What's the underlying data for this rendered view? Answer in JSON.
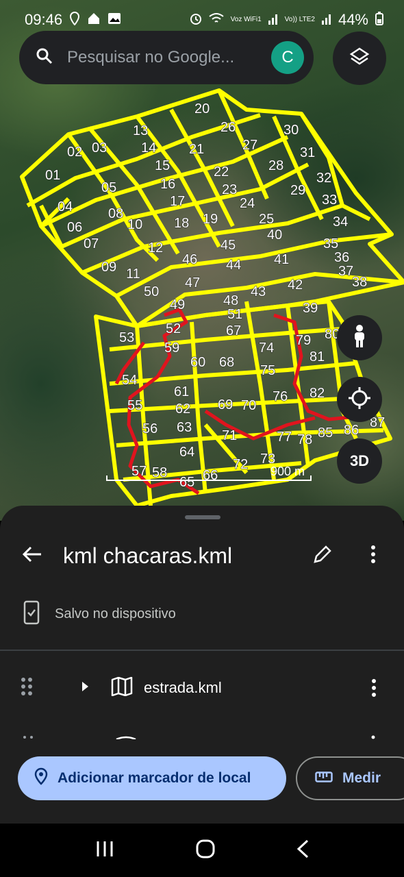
{
  "status_bar": {
    "time": "09:46",
    "battery": "44%",
    "network_label_1": "Voz WiFi1",
    "network_label_2": "Vo)) LTE2"
  },
  "search": {
    "placeholder": "Pesquisar no Google...",
    "avatar_letter": "C"
  },
  "map": {
    "plot_labels": [
      "01",
      "02",
      "03",
      "04",
      "05",
      "06",
      "07",
      "08",
      "09",
      "10",
      "11",
      "12",
      "13",
      "14",
      "15",
      "16",
      "17",
      "18",
      "19",
      "20",
      "21",
      "22",
      "23",
      "24",
      "25",
      "26",
      "27",
      "28",
      "29",
      "30",
      "31",
      "32",
      "33",
      "34",
      "35",
      "36",
      "37",
      "38",
      "39",
      "40",
      "41",
      "42",
      "43",
      "44",
      "45",
      "46",
      "47",
      "48",
      "49",
      "50",
      "51",
      "52",
      "53",
      "54",
      "55",
      "56",
      "57",
      "58",
      "59",
      "60",
      "61",
      "62",
      "63",
      "64",
      "65",
      "66",
      "67",
      "68",
      "69",
      "70",
      "71",
      "72",
      "73",
      "74",
      "75",
      "76",
      "77",
      "78",
      "79",
      "80",
      "81",
      "82",
      "85",
      "86",
      "87"
    ],
    "scale_label": "900 m",
    "btn_3d_label": "3D",
    "colors": {
      "boundary": "#ffff00",
      "road": "#e0141e"
    }
  },
  "sheet": {
    "title": "kml chacaras.kml",
    "saved_text": "Salvo no dispositivo",
    "layers": [
      {
        "name": "estrada.kml"
      }
    ]
  },
  "actions": {
    "add_marker_label": "Adicionar marcador de local",
    "measure_label": "Medir",
    "colors": {
      "primary": "#aac7ff",
      "primary_text": "#062e6f"
    }
  },
  "icons": {
    "search": "search-icon",
    "layers": "layers-icon",
    "pegman": "pegman-icon",
    "locate": "my-location-icon",
    "back": "arrow-back-icon",
    "edit": "pencil-icon",
    "more": "more-vert-icon",
    "saved": "phone-check-icon",
    "drag": "drag-handle-icon",
    "expand": "chevron-right-icon",
    "map": "map-icon",
    "pin": "location-pin-icon",
    "ruler": "ruler-icon"
  }
}
